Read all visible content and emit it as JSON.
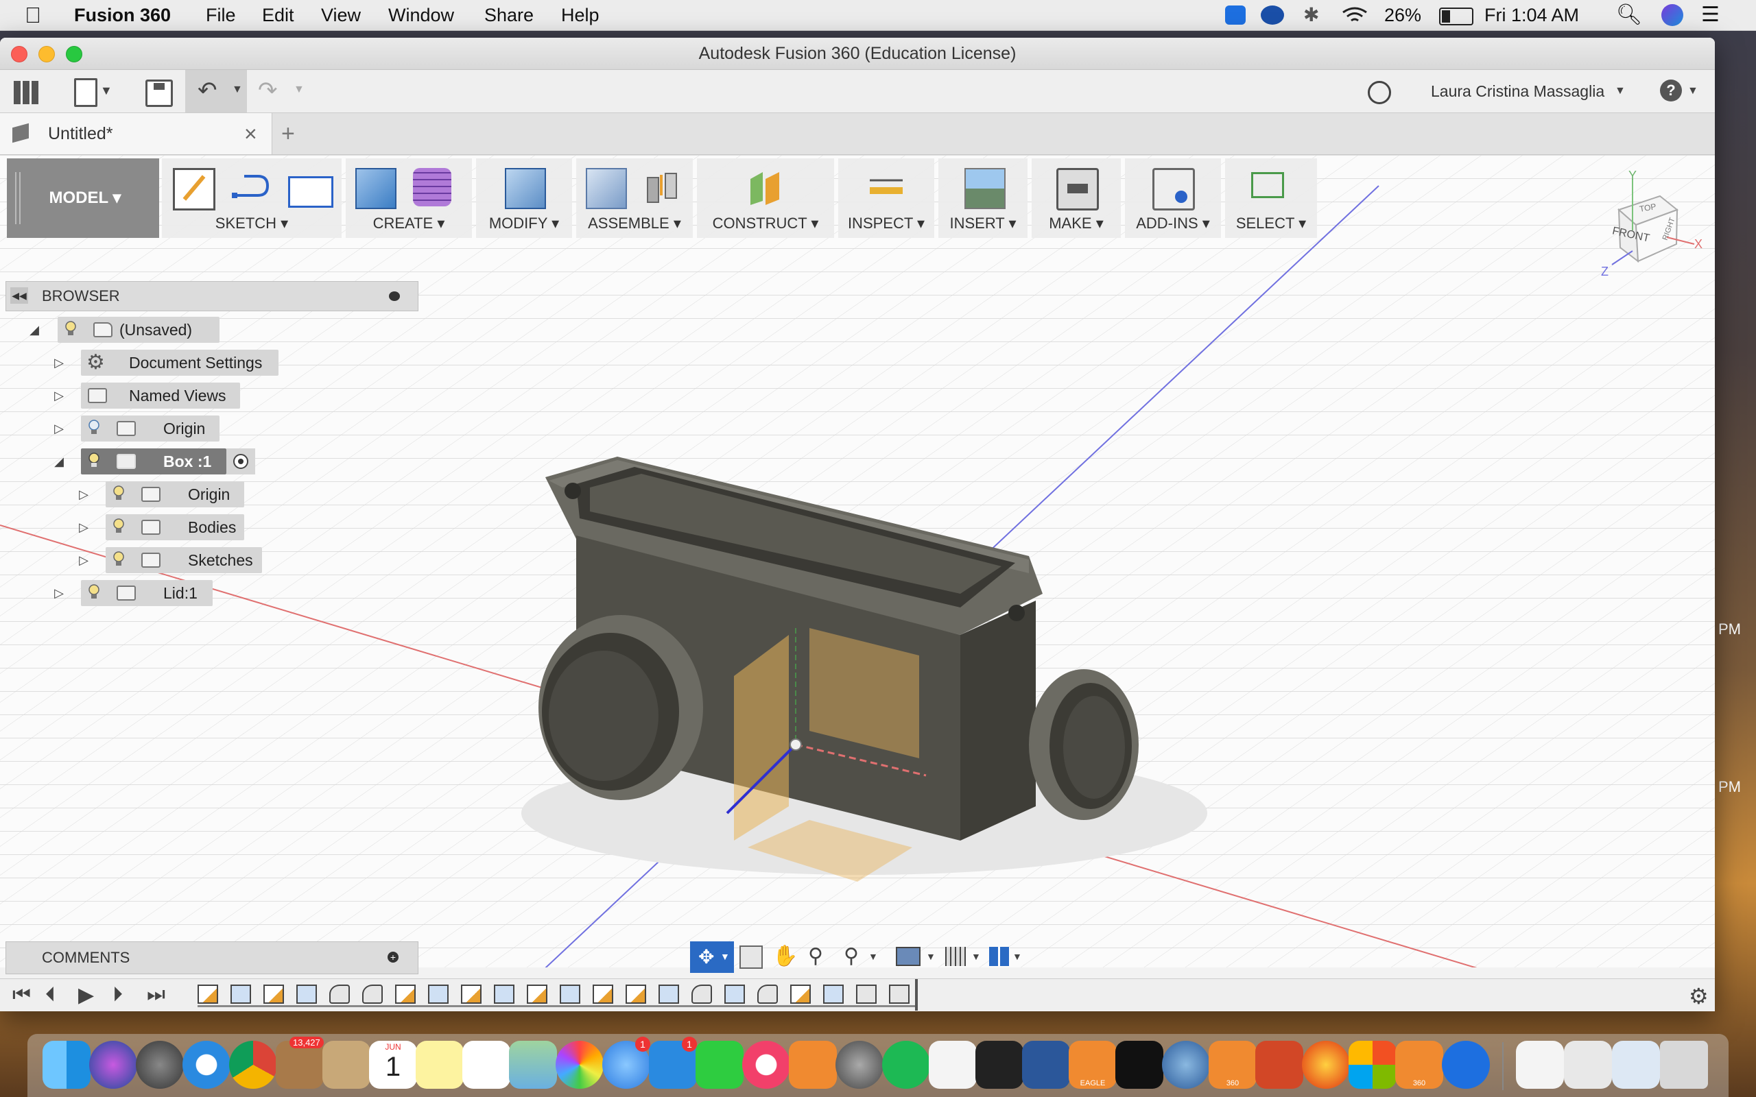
{
  "menubar": {
    "app_name": "Fusion 360",
    "items": [
      "File",
      "Edit",
      "View",
      "Window",
      "Share",
      "Help"
    ],
    "battery": "26%",
    "clock": "Fri 1:04 AM"
  },
  "window": {
    "title": "Autodesk Fusion 360 (Education License)",
    "user": "Laura Cristina Massaglia",
    "help": "?"
  },
  "tab": {
    "title": "Untitled*",
    "close": "×",
    "new": "+"
  },
  "ribbon": {
    "workspace": "MODEL",
    "groups": [
      "SKETCH",
      "CREATE",
      "MODIFY",
      "ASSEMBLE",
      "CONSTRUCT",
      "INSPECT",
      "INSERT",
      "MAKE",
      "ADD-INS",
      "SELECT"
    ]
  },
  "browser": {
    "title": "BROWSER",
    "nodes": {
      "root": "(Unsaved)",
      "doc_settings": "Document Settings",
      "named_views": "Named Views",
      "origin": "Origin",
      "box": "Box :1",
      "box_origin": "Origin",
      "bodies": "Bodies",
      "sketches": "Sketches",
      "lid": "Lid:1"
    }
  },
  "viewcube": {
    "front": "FRONT",
    "top": "TOP",
    "right": "RIGHT",
    "axes": [
      "X",
      "Y",
      "Z"
    ]
  },
  "comments": {
    "title": "COMMENTS"
  },
  "desktop": {
    "side_labels": [
      "PM",
      "PM"
    ]
  },
  "dock": {
    "badges": {
      "photos": "13,427",
      "calendar_month": "JUN",
      "calendar_day": "1",
      "messages": "1",
      "appstore": "1",
      "eagle_label": "EAGLE",
      "fusion_label": "360"
    }
  },
  "colors": {
    "accent_blue": "#1d6fe0",
    "model_body": "#55544e",
    "construction_plane": "#e8b45a",
    "axis_red": "#e07070",
    "axis_blue": "#5a5ae0",
    "menu_text": "#111111"
  }
}
